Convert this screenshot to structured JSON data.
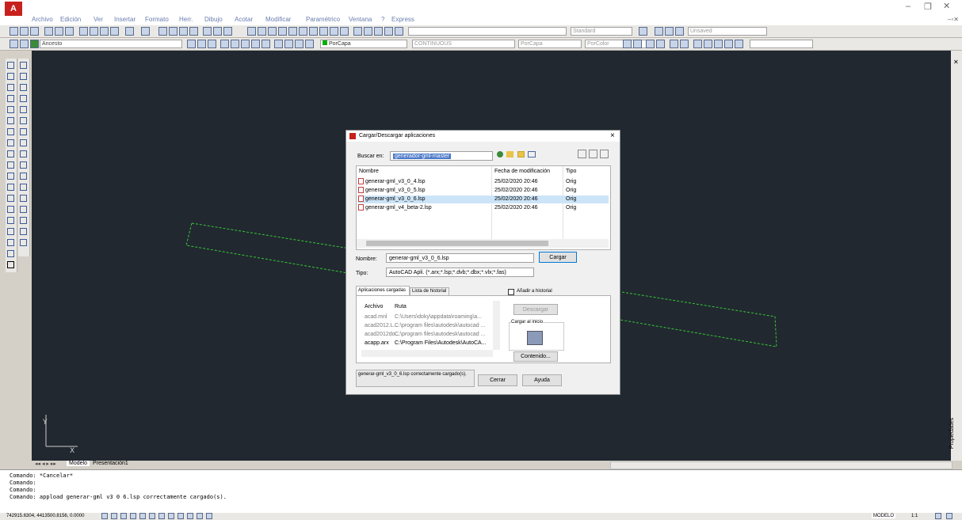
{
  "menu": {
    "items": [
      "Archivo",
      "Edición",
      "Ver",
      "Insertar",
      "Formato",
      "Herr.",
      "Dibujo",
      "Acotar",
      "Modificar",
      "Paramétrico",
      "Ventana",
      "?",
      "Express"
    ]
  },
  "toolbars": {
    "style_combo": "Standard",
    "viewport_combo": "Unsaved",
    "layer_combo": "Ancesto",
    "color_combo": "PorCapa",
    "linetype_combo": "CONTINUOUS",
    "lineweight_combo": "PorCapa",
    "plotstyle_combo": "PorColor"
  },
  "canvas": {
    "line_color": "#36c832",
    "background": "#212830"
  },
  "dialog": {
    "title": "Cargar/Descargar aplicaciones",
    "close": "×",
    "lookin_label": "Buscar en:",
    "lookin_value": "generador-gml-master",
    "col_name": "Nombre",
    "col_date": "Fecha de modificación",
    "col_type": "Tipo",
    "files": [
      {
        "name": "generar-gml_v3_0_4.lsp",
        "date": "25/02/2020 20:46",
        "type": "Orig"
      },
      {
        "name": "generar-gml_v3_0_5.lsp",
        "date": "25/02/2020 20:46",
        "type": "Orig"
      },
      {
        "name": "generar-gml_v3_0_6.lsp",
        "date": "25/02/2020 20:46",
        "type": "Orig"
      },
      {
        "name": "generar-gml_v4_beta-2.lsp",
        "date": "25/02/2020 20:46",
        "type": "Orig"
      }
    ],
    "name_label": "Nombre:",
    "name_value": "generar-gml_v3_0_6.lsp",
    "load_button": "Cargar",
    "type_label": "Tipo:",
    "type_value": "AutoCAD Apli. (*.arx;*.lsp;*.dvb;*.dbx;*.vlx;*.fas)",
    "tab_loaded": "Aplicaciones cargadas",
    "tab_history": "Lista de historial",
    "add_history": "Añadir a historial",
    "loaded_col_file": "Archivo",
    "loaded_col_path": "Ruta",
    "loaded": [
      {
        "file": "acad.mnl",
        "path": "C:\\Users\\doky\\appdata\\roaming\\a..."
      },
      {
        "file": "acad2012.L...",
        "path": "C:\\program files\\autodesk\\autocad ..."
      },
      {
        "file": "acad2012do...",
        "path": "C:\\program files\\autodesk\\autocad ..."
      },
      {
        "file": "acapp.arx",
        "path": "C:\\Program Files\\Autodesk\\AutoCA..."
      }
    ],
    "unload_button": "Descargar",
    "startup_label": "Cargar al inicio",
    "contents_button": "Contenido...",
    "status_text": "generar-gml_v3_0_6.lsp correctamente cargado(s).",
    "close_button": "Cerrar",
    "help_button": "Ayuda"
  },
  "tabs": {
    "model": "Modelo",
    "layout": "Presentación1"
  },
  "palette_label": "Propiedades",
  "command_lines": [
    "Comando: *Cancelar*",
    "Comando:",
    "Comando:",
    "Comando:  appload generar-gml v3 0 6.lsp correctamente cargado(s)."
  ],
  "status": {
    "coords": "742915.6304, 4413500.8156, 0.0000",
    "model_label": "MODELO",
    "scale_label": "1:1"
  }
}
